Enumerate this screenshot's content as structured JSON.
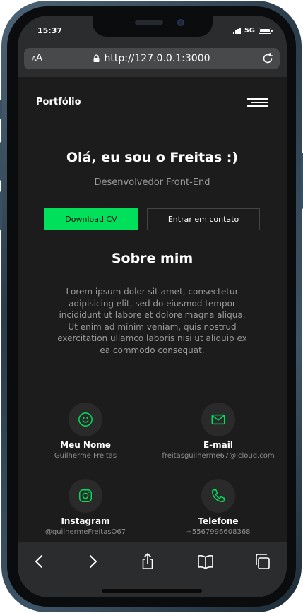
{
  "status": {
    "time": "15:37",
    "network": "5G"
  },
  "browser": {
    "text_size": "AA",
    "url": "http://127.0.0.1:3000"
  },
  "nav": {
    "brand": "Portfólio"
  },
  "hero": {
    "title": "Olá, eu sou o Freitas :)",
    "subtitle": "Desenvolvedor Front-End",
    "primary_button": "Download CV",
    "secondary_button": "Entrar em contato"
  },
  "about": {
    "title": "Sobre mim",
    "text": "Lorem ipsum dolor sit amet, consectetur adipisicing elit, sed do eiusmod tempor incididunt ut labore et dolore magna aliqua. Ut enim ad minim veniam, quis nostrud exercitation ullamco laboris nisi ut aliquip ex ea commodo consequat."
  },
  "info": [
    {
      "icon": "smile-icon",
      "label": "Meu Nome",
      "value": "Guilherme Freitas"
    },
    {
      "icon": "mail-icon",
      "label": "E-mail",
      "value": "freitasguilherme67@icloud.com"
    },
    {
      "icon": "instagram-icon",
      "label": "Instagram",
      "value": "@guilhermeFreitasO67"
    },
    {
      "icon": "phone-icon",
      "label": "Telefone",
      "value": "+5567996608368"
    }
  ],
  "colors": {
    "accent": "#00e05b",
    "background": "#1c1c1c",
    "browser_chrome": "#2a2c2e"
  }
}
